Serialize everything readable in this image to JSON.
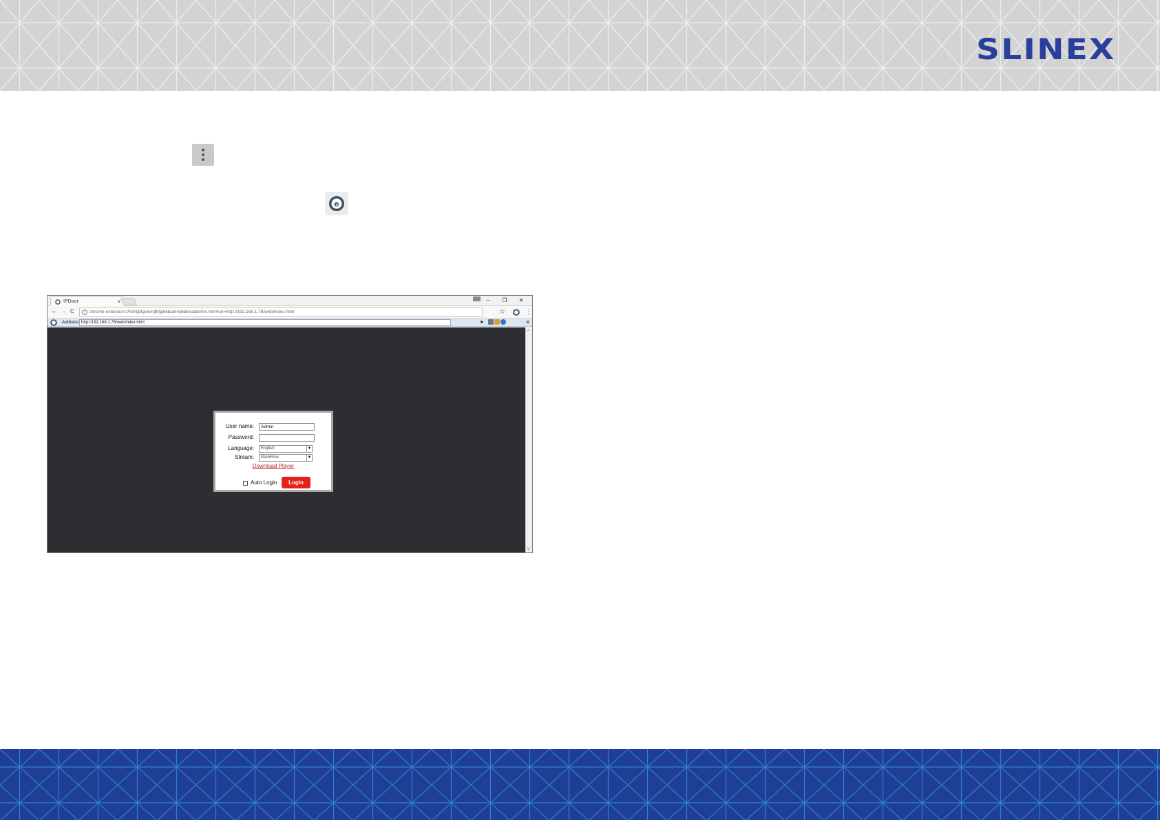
{
  "brand": {
    "logo_text": "SLINEX",
    "logo_color": "#2a3f9b",
    "header_color": "#d3d3d3",
    "footer_color": "#1f3f94"
  },
  "page_icons": {
    "menu_dots": "vertical-ellipsis-icon",
    "extension": "ie-tab-extension-icon"
  },
  "browser": {
    "tab": {
      "title": "IPDoor",
      "close": "×",
      "favicon": "ie-tab-icon"
    },
    "window_controls": {
      "minimize": "–",
      "restore": "❐",
      "close": "✕"
    },
    "nav": {
      "back": "←",
      "forward": "→",
      "reload": "C",
      "url": "chrome-extension://hehijbfgiekmjfkfjpbkbammjbdenadd/nhc.htm#url=http://192.168.1.78/web/index.html",
      "star": "☆",
      "menu": "⋮"
    },
    "ie_bar": {
      "address_label": "Address:",
      "address_value": "http://192.168.1.78/web/index.html",
      "go": "►",
      "close": "✕"
    },
    "scrollbar": {
      "up": "^",
      "down": "v"
    }
  },
  "login": {
    "username_label": "User name:",
    "username_value": "Admin",
    "password_label": "Password:",
    "password_value": "",
    "language_label": "Language:",
    "language_value": "English",
    "stream_label": "Stream:",
    "stream_value": "MainFlow",
    "download_link": "Download Player",
    "auto_login_label": "Auto Login",
    "auto_login_checked": false,
    "login_button": "Login",
    "login_button_color": "#e3211f"
  }
}
